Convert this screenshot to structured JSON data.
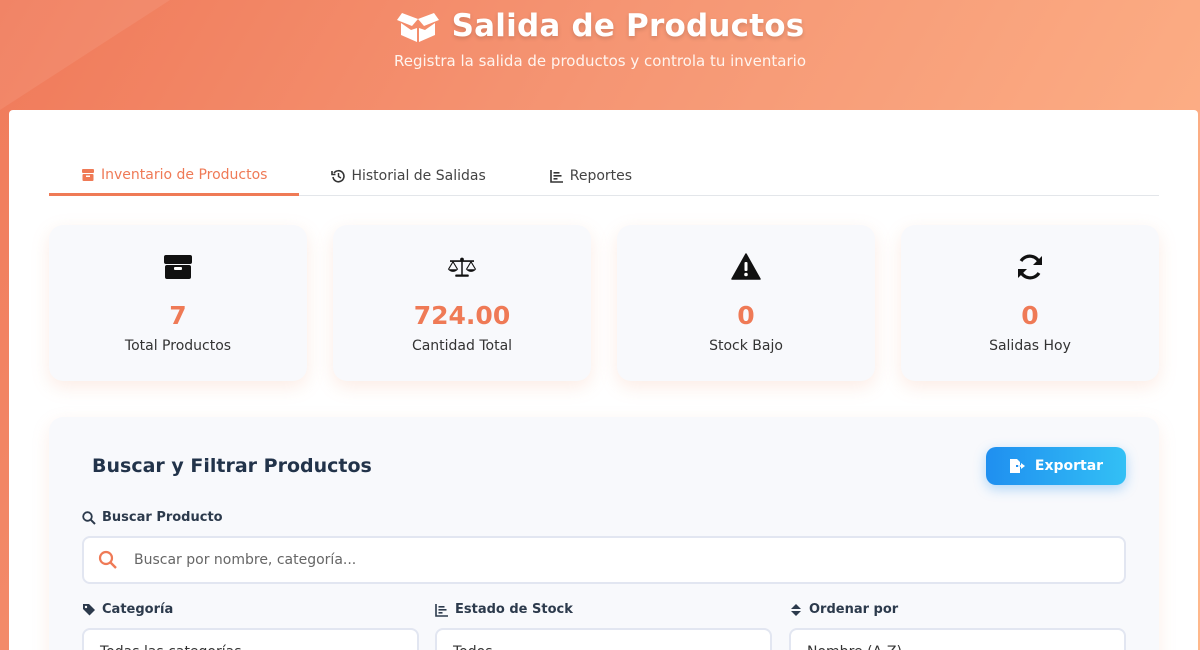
{
  "header": {
    "title": "Salida de Productos",
    "subtitle": "Registra la salida de productos y controla tu inventario",
    "title_icon": "box-open-icon"
  },
  "tabs": [
    {
      "label": "Inventario de Productos",
      "icon": "box-icon",
      "active": true
    },
    {
      "label": "Historial de Salidas",
      "icon": "history-icon",
      "active": false
    },
    {
      "label": "Reportes",
      "icon": "chart-icon",
      "active": false
    }
  ],
  "stats": [
    {
      "value": "7",
      "label": "Total Productos",
      "icon": "box-icon"
    },
    {
      "value": "724.00",
      "label": "Cantidad Total",
      "icon": "balance-scale-icon"
    },
    {
      "value": "0",
      "label": "Stock Bajo",
      "icon": "warning-icon"
    },
    {
      "value": "0",
      "label": "Salidas Hoy",
      "icon": "refresh-icon"
    }
  ],
  "filters": {
    "title": "Buscar y Filtrar Productos",
    "export_label": "Exportar",
    "search_label": "Buscar Producto",
    "search_placeholder": "Buscar por nombre, categoría...",
    "category_label": "Categoría",
    "category_value": "Todas las categorías",
    "stock_label": "Estado de Stock",
    "stock_value": "Todos",
    "sort_label": "Ordenar por",
    "sort_value": "Nombre (A-Z)"
  },
  "colors": {
    "accent": "#ef7a56",
    "export_button": "#1f8ff0",
    "heading": "#22334a"
  }
}
